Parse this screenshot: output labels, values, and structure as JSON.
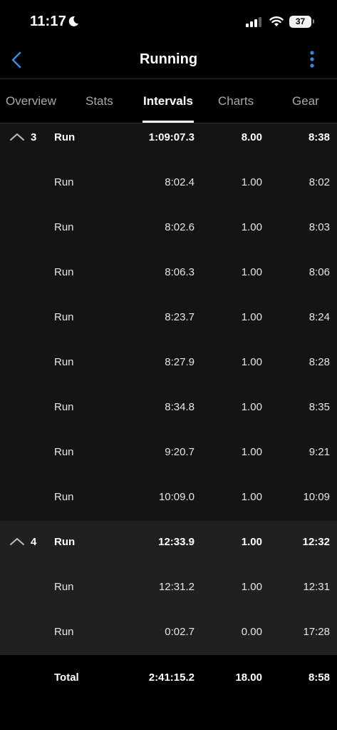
{
  "status_bar": {
    "time": "11:17",
    "battery": "37",
    "icons": [
      "moon-icon",
      "signal-icon",
      "wifi-icon",
      "battery-icon"
    ]
  },
  "nav": {
    "title": "Running",
    "back_icon": "chevron-left-icon",
    "more_icon": "vertical-ellipsis-icon",
    "accent_color": "#2f8ce6"
  },
  "tabs": [
    {
      "label": "Overview"
    },
    {
      "label": "Stats"
    },
    {
      "label": "Intervals"
    },
    {
      "label": "Charts"
    },
    {
      "label": "Gear"
    }
  ],
  "active_tab": "Intervals",
  "intervals": [
    {
      "number": "3",
      "summary": {
        "name": "Run",
        "time": "1:09:07.3",
        "distance": "8.00",
        "pace": "8:38"
      },
      "laps": [
        {
          "name": "Run",
          "time": "8:02.4",
          "distance": "1.00",
          "pace": "8:02"
        },
        {
          "name": "Run",
          "time": "8:02.6",
          "distance": "1.00",
          "pace": "8:03"
        },
        {
          "name": "Run",
          "time": "8:06.3",
          "distance": "1.00",
          "pace": "8:06"
        },
        {
          "name": "Run",
          "time": "8:23.7",
          "distance": "1.00",
          "pace": "8:24"
        },
        {
          "name": "Run",
          "time": "8:27.9",
          "distance": "1.00",
          "pace": "8:28"
        },
        {
          "name": "Run",
          "time": "8:34.8",
          "distance": "1.00",
          "pace": "8:35"
        },
        {
          "name": "Run",
          "time": "9:20.7",
          "distance": "1.00",
          "pace": "9:21"
        },
        {
          "name": "Run",
          "time": "10:09.0",
          "distance": "1.00",
          "pace": "10:09"
        }
      ]
    },
    {
      "number": "4",
      "summary": {
        "name": "Run",
        "time": "12:33.9",
        "distance": "1.00",
        "pace": "12:32"
      },
      "laps": [
        {
          "name": "Run",
          "time": "12:31.2",
          "distance": "1.00",
          "pace": "12:31"
        },
        {
          "name": "Run",
          "time": "0:02.7",
          "distance": "0.00",
          "pace": "17:28"
        }
      ]
    }
  ],
  "total": {
    "label": "Total",
    "time": "2:41:15.2",
    "distance": "18.00",
    "pace": "8:58"
  }
}
